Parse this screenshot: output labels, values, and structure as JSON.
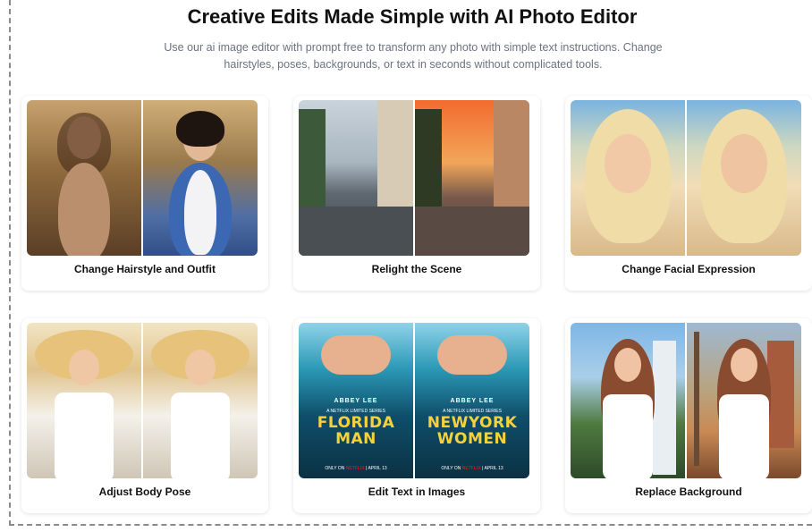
{
  "header": {
    "title": "Creative Edits Made Simple with AI Photo Editor",
    "subtitle": "Use our ai image editor with prompt free to transform any photo with simple text instructions. Change hairstyles, poses, backgrounds, or text in seconds without complicated tools."
  },
  "cards": [
    {
      "label": "Change Hairstyle and Outfit"
    },
    {
      "label": "Relight the Scene"
    },
    {
      "label": "Change Facial Expression"
    },
    {
      "label": "Adjust Body Pose"
    },
    {
      "label": "Edit Text in Images"
    },
    {
      "label": "Replace Background"
    }
  ],
  "poster": {
    "name": "ABBEY LEE",
    "series": "A NETFLIX LIMITED SERIES",
    "before_title_1": "FLORIDA",
    "before_title_2": "MAN",
    "after_title_1": "NEWYORK",
    "after_title_2": "WOMEN",
    "only_on": "ONLY ON",
    "brand": "NETFLIX",
    "date": "APRIL 13"
  }
}
